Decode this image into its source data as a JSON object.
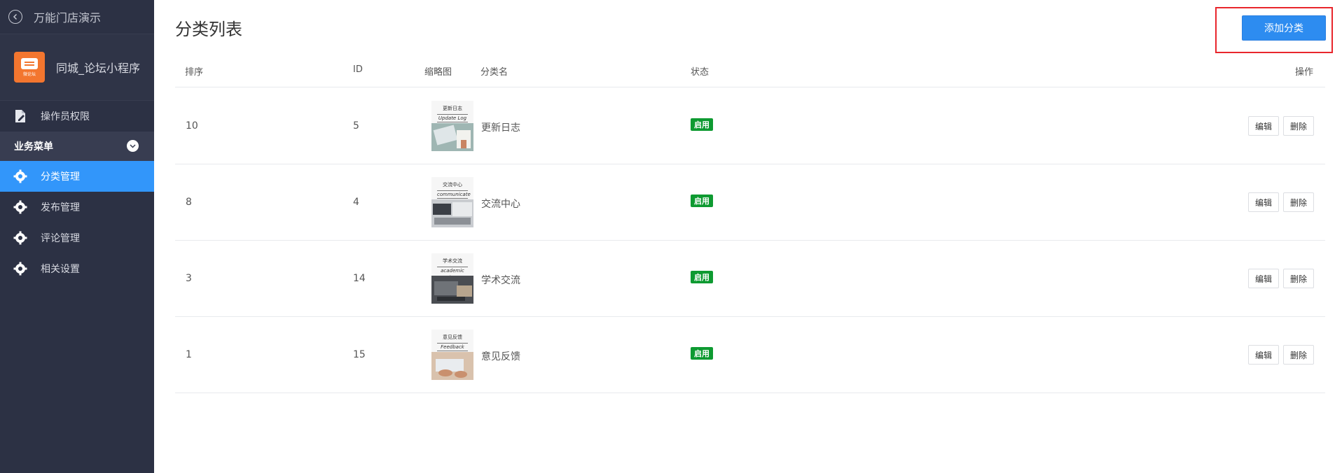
{
  "sidebar": {
    "back_label": "万能门店演示",
    "app_name": "同城_论坛小程序",
    "logo_text": "微论坛",
    "permission_item": "操作员权限",
    "group_title": "业务菜单",
    "items": [
      {
        "label": "分类管理",
        "active": true
      },
      {
        "label": "发布管理",
        "active": false
      },
      {
        "label": "评论管理",
        "active": false
      },
      {
        "label": "相关设置",
        "active": false
      }
    ]
  },
  "page": {
    "title": "分类列表",
    "add_button": "添加分类"
  },
  "table": {
    "headers": {
      "sort": "排序",
      "id": "ID",
      "thumb": "缩略图",
      "name": "分类名",
      "status": "状态",
      "action": "操作"
    },
    "rows": [
      {
        "sort": "10",
        "id": "5",
        "name": "更新日志",
        "status": "启用",
        "thumb_cn": "更新日志",
        "thumb_en": "Update Log",
        "edit": "编辑",
        "delete": "删除"
      },
      {
        "sort": "8",
        "id": "4",
        "name": "交流中心",
        "status": "启用",
        "thumb_cn": "交流中心",
        "thumb_en": "communicate",
        "edit": "编辑",
        "delete": "删除"
      },
      {
        "sort": "3",
        "id": "14",
        "name": "学术交流",
        "status": "启用",
        "thumb_cn": "学术交流",
        "thumb_en": "academic Exchange",
        "edit": "编辑",
        "delete": "删除"
      },
      {
        "sort": "1",
        "id": "15",
        "name": "意见反馈",
        "status": "启用",
        "thumb_cn": "意见反馈",
        "thumb_en": "Feedback",
        "edit": "编辑",
        "delete": "删除"
      }
    ]
  },
  "colors": {
    "sidebar_bg": "#2c3144",
    "active_item": "#3296fa",
    "primary_button": "#2d8cf0",
    "status_badge": "#0e9a31",
    "highlight_border": "#e8262c"
  }
}
